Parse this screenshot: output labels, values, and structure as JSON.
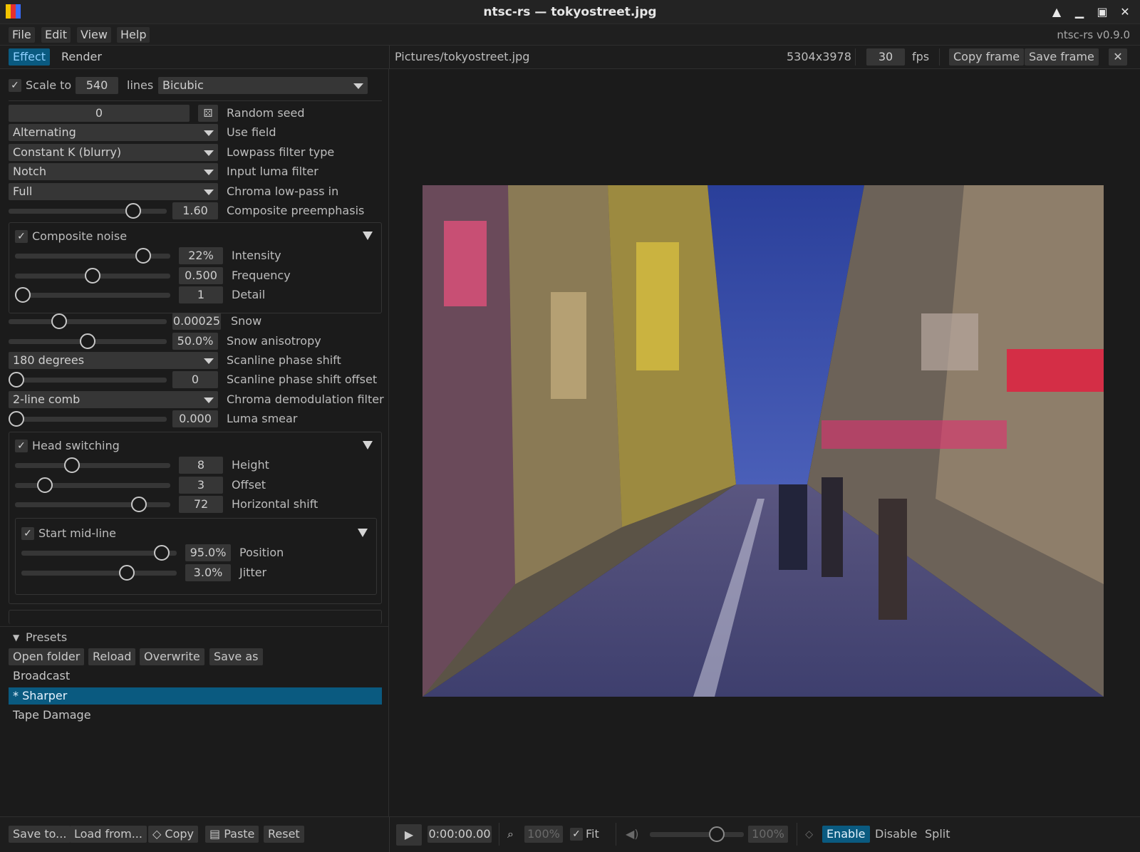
{
  "window": {
    "title": "ntsc-rs — tokyostreet.jpg",
    "version": "ntsc-rs v0.9.0"
  },
  "menu": [
    "File",
    "Edit",
    "View",
    "Help"
  ],
  "tabs": {
    "effect": "Effect",
    "render": "Render"
  },
  "file": {
    "path": "Pictures/tokyostreet.jpg",
    "dimensions": "5304x3978",
    "fps_value": "30",
    "fps_label": "fps",
    "copy_frame": "Copy frame",
    "save_frame": "Save frame"
  },
  "scale": {
    "label": "Scale to",
    "value": "540",
    "unit": "lines",
    "filter": "Bicubic",
    "checked": true
  },
  "settings": {
    "random_seed": {
      "value": "0",
      "label": "Random seed"
    },
    "use_field": {
      "value": "Alternating",
      "label": "Use field"
    },
    "lowpass": {
      "value": "Constant K (blurry)",
      "label": "Lowpass filter type"
    },
    "input_luma": {
      "value": "Notch",
      "label": "Input luma filter"
    },
    "chroma_lowpass": {
      "value": "Full",
      "label": "Chroma low-pass in"
    },
    "composite_preemphasis": {
      "value": "1.60",
      "label": "Composite preemphasis",
      "level": 0.82
    },
    "composite_noise": {
      "label": "Composite noise",
      "checked": true,
      "intensity": {
        "value": "22%",
        "label": "Intensity",
        "level": 0.86
      },
      "frequency": {
        "value": "0.500",
        "label": "Frequency",
        "level": 0.5
      },
      "detail": {
        "value": "1",
        "label": "Detail",
        "level": 0.0
      }
    },
    "snow": {
      "value": "0.00025",
      "label": "Snow",
      "level": 0.3
    },
    "snow_anisotropy": {
      "value": "50.0%",
      "label": "Snow anisotropy",
      "level": 0.5
    },
    "scanline_phase_shift": {
      "value": "180 degrees",
      "label": "Scanline phase shift"
    },
    "scanline_phase_shift_offset": {
      "value": "0",
      "label": "Scanline phase shift offset",
      "level": 0.0
    },
    "chroma_demod": {
      "value": "2-line comb",
      "label": "Chroma demodulation filter"
    },
    "luma_smear": {
      "value": "0.000",
      "label": "Luma smear",
      "level": 0.0
    },
    "head_switching": {
      "label": "Head switching",
      "checked": true,
      "height": {
        "value": "8",
        "label": "Height",
        "level": 0.35
      },
      "offset": {
        "value": "3",
        "label": "Offset",
        "level": 0.16
      },
      "horizontal_shift": {
        "value": "72",
        "label": "Horizontal shift",
        "level": 0.83
      },
      "start_mid_line": {
        "label": "Start mid-line",
        "checked": true,
        "position": {
          "value": "95.0%",
          "label": "Position",
          "level": 0.95
        },
        "jitter": {
          "value": "3.0%",
          "label": "Jitter",
          "level": 0.7
        }
      }
    }
  },
  "presets": {
    "header": "Presets",
    "buttons": [
      "Open folder",
      "Reload",
      "Overwrite",
      "Save as"
    ],
    "items": [
      {
        "label": "Broadcast",
        "selected": false
      },
      {
        "label": "* Sharper",
        "selected": true
      },
      {
        "label": "Tape Damage",
        "selected": false
      }
    ]
  },
  "bottom": {
    "save_to": "Save to...",
    "load_from": "Load from...",
    "copy": "Copy",
    "paste": "Paste",
    "reset": "Reset",
    "timecode": "0:00:00.00",
    "zoom": "100%",
    "fit": "Fit",
    "volume": "100%",
    "volume_level": 0.75,
    "enable": "Enable",
    "disable": "Disable",
    "split": "Split"
  },
  "icons": [
    "app-logo-icon",
    "minimize-icon",
    "maximize-icon",
    "restore-icon",
    "close-icon",
    "dice-icon",
    "play-icon",
    "zoom-icon",
    "volume-icon",
    "compare-icon",
    "copy-icon",
    "paste-icon"
  ],
  "colors": {
    "accent": "#0a5a80",
    "accent_text": "#8ed0ff",
    "panel": "#1b1b1b",
    "widget": "#363636"
  }
}
